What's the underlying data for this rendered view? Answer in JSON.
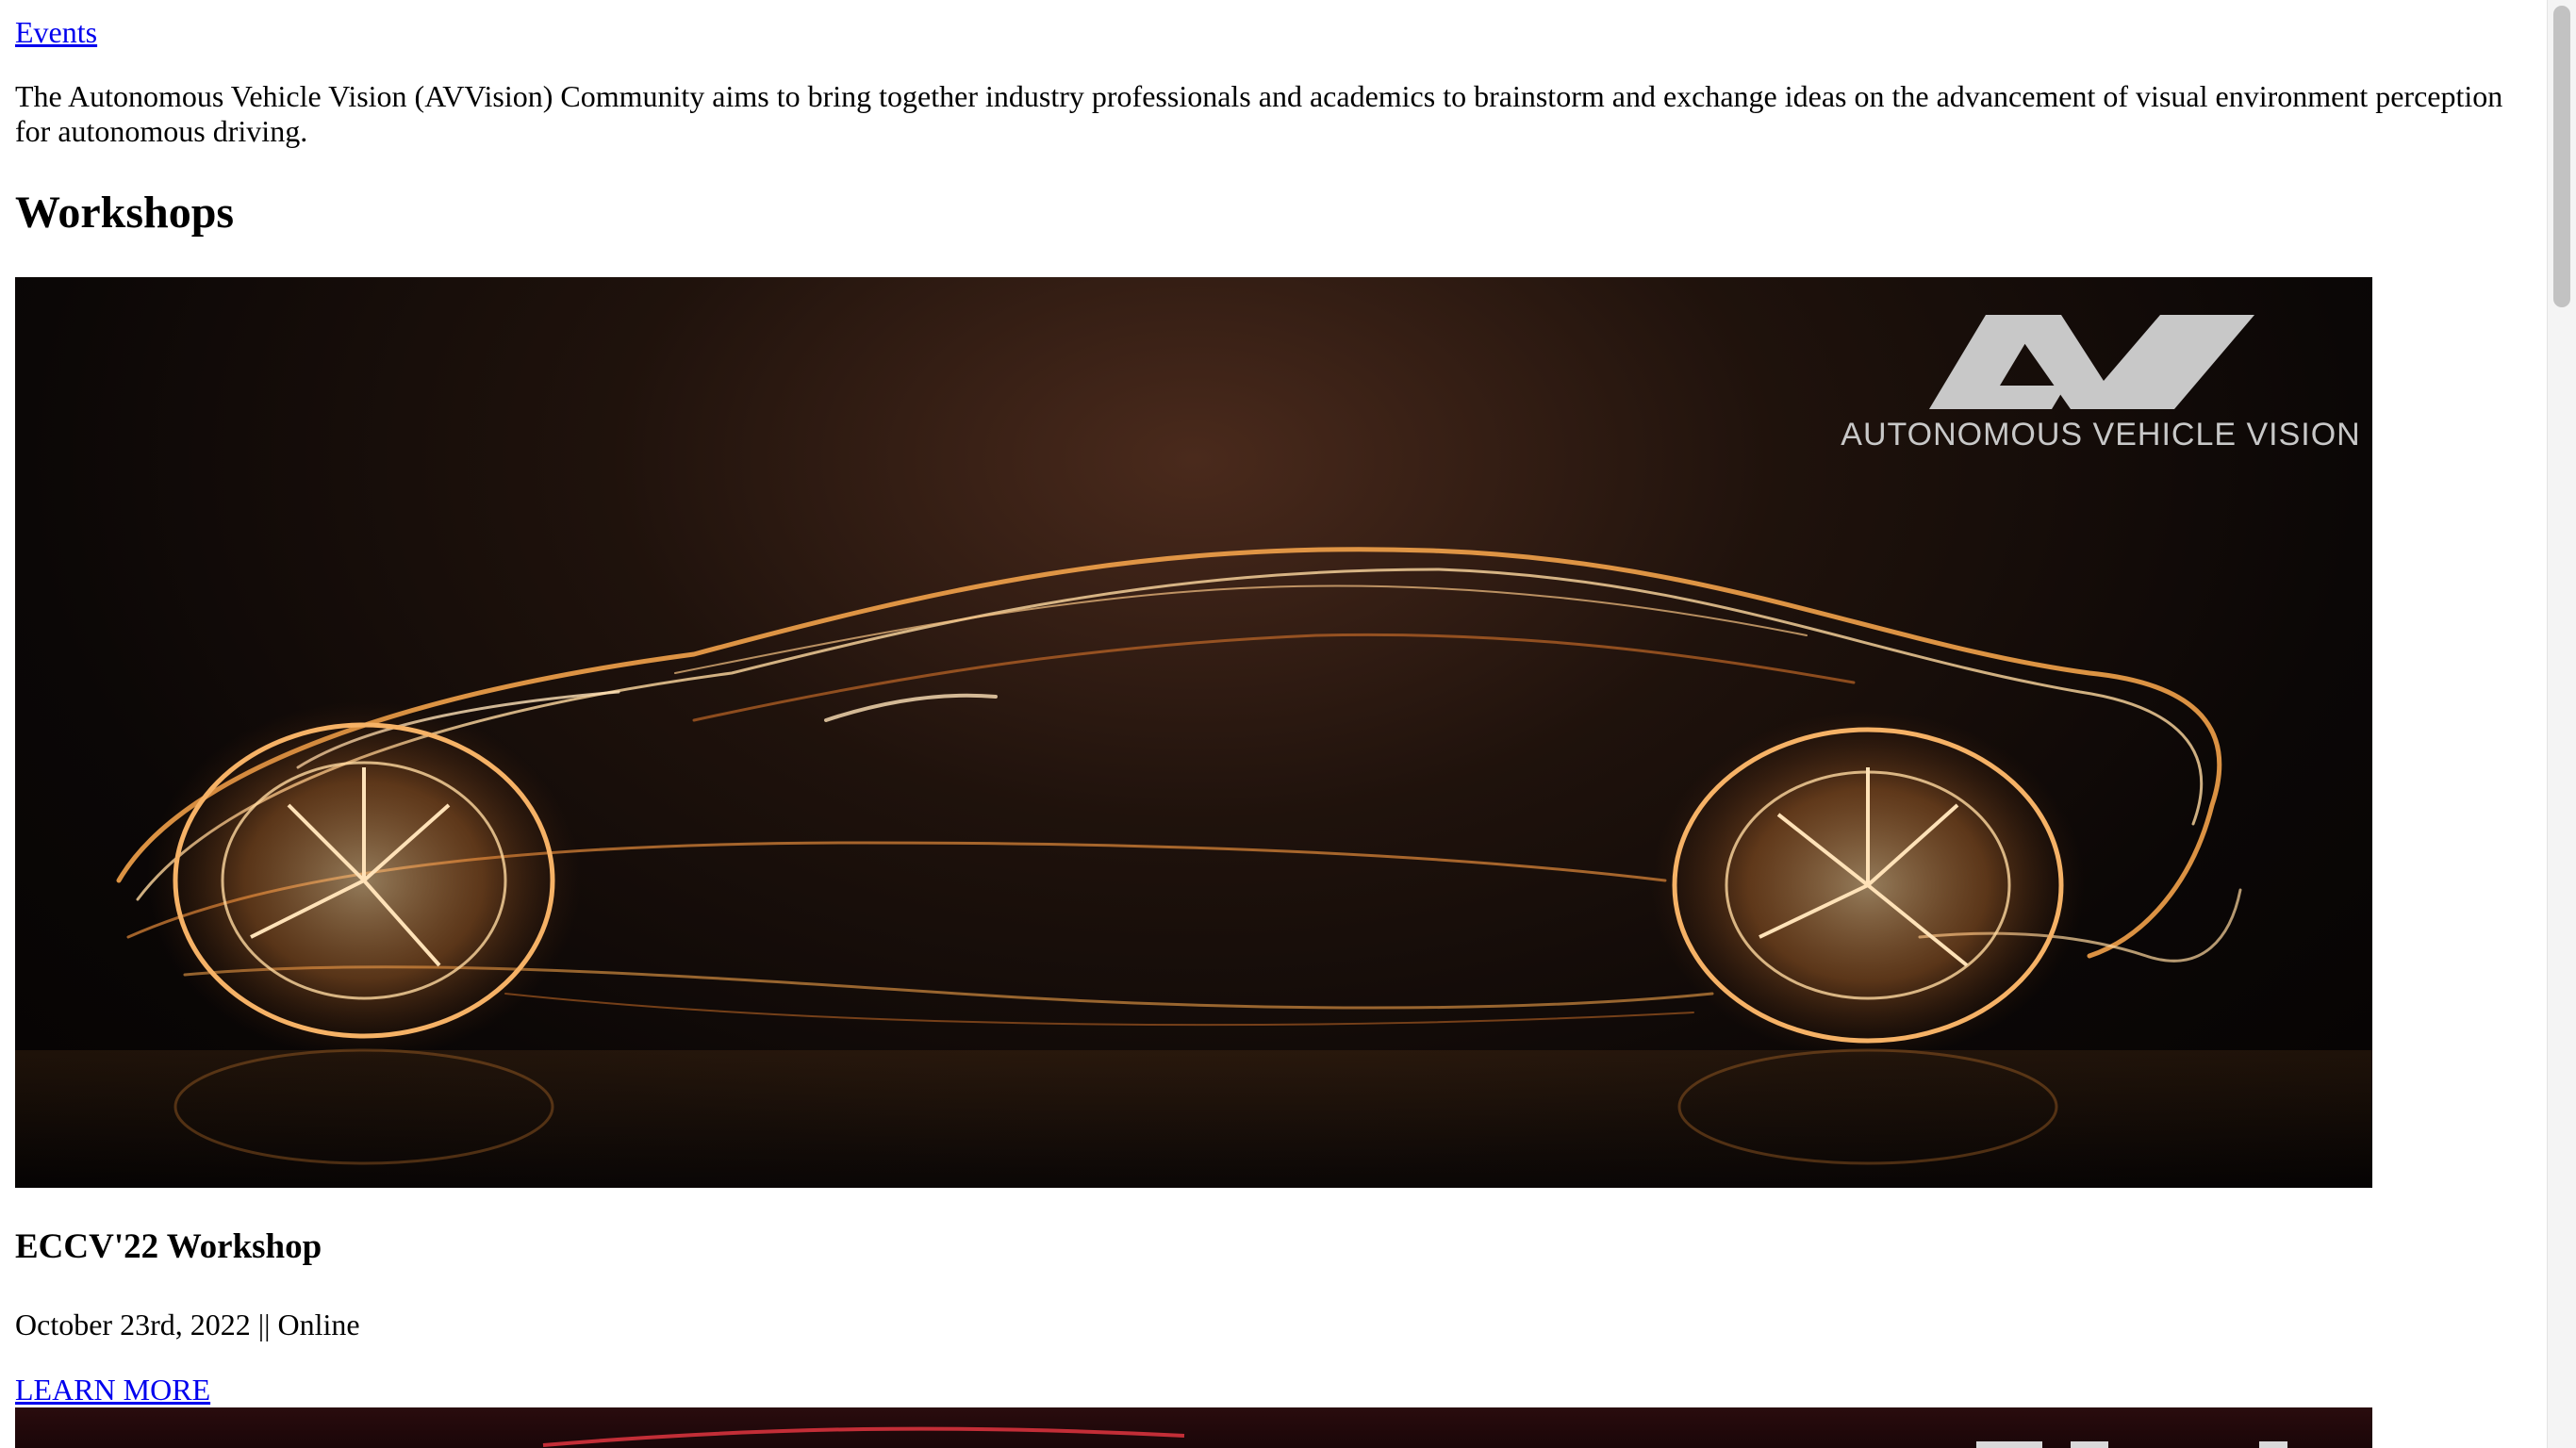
{
  "nav": {
    "events_label": "Events"
  },
  "intro": {
    "text": "The Autonomous Vehicle Vision (AVVision) Community aims to bring together industry professionals and academics to brainstorm and exchange ideas on the advancement of visual environment perception for autonomous driving."
  },
  "workshops": {
    "heading": "Workshops",
    "items": [
      {
        "banner_logo_text": "AUTONOMOUS VEHICLE VISION",
        "title": "ECCV'22 Workshop",
        "date_location": "October 23rd, 2022 || Online",
        "learn_more_label": "LEARN MORE"
      }
    ]
  },
  "colors": {
    "link": "#0000ee",
    "text": "#000000",
    "banner_glow": "#f2a24a",
    "logo_gray": "#c8c8c8"
  }
}
